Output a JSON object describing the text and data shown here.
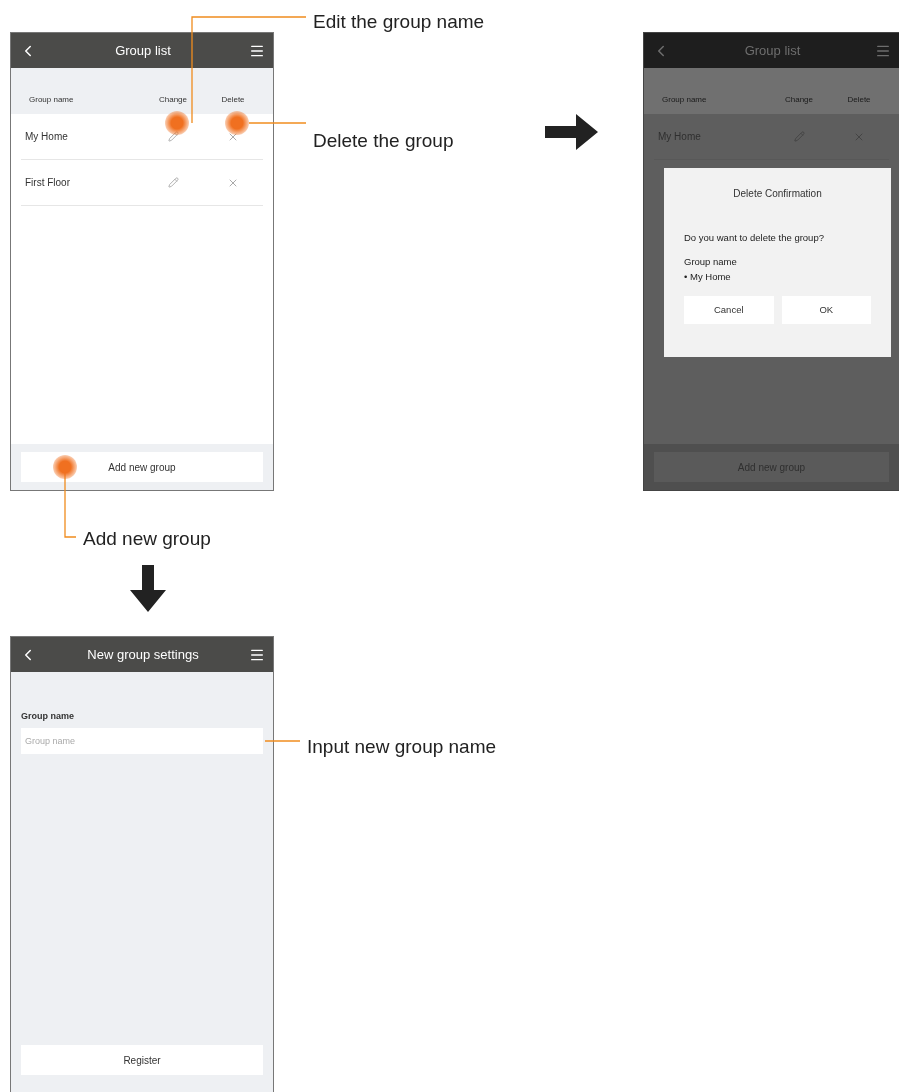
{
  "group_list_screen": {
    "title": "Group list",
    "columns": [
      "Group name",
      "Change",
      "Delete"
    ],
    "rows": [
      {
        "name": "My Home"
      },
      {
        "name": "First Floor"
      }
    ],
    "add_button": "Add new group"
  },
  "delete_confirmation_screen": {
    "title": "Group list",
    "columns": [
      "Group name",
      "Change",
      "Delete"
    ],
    "rows": [
      {
        "name": "My Home"
      }
    ],
    "add_button": "Add new group",
    "dialog": {
      "title": "Delete Confirmation",
      "message": "Do you want to delete the group?",
      "label": "Group name",
      "value": "• My Home",
      "buttons": [
        "Cancel",
        "OK"
      ]
    }
  },
  "new_group_settings_screen": {
    "title": "New group settings",
    "field_label": "Group name",
    "placeholder": "Group name",
    "button": "Register"
  },
  "callouts": [
    "Edit the group name",
    "Delete the group",
    "Add new group",
    "Input new group name"
  ]
}
